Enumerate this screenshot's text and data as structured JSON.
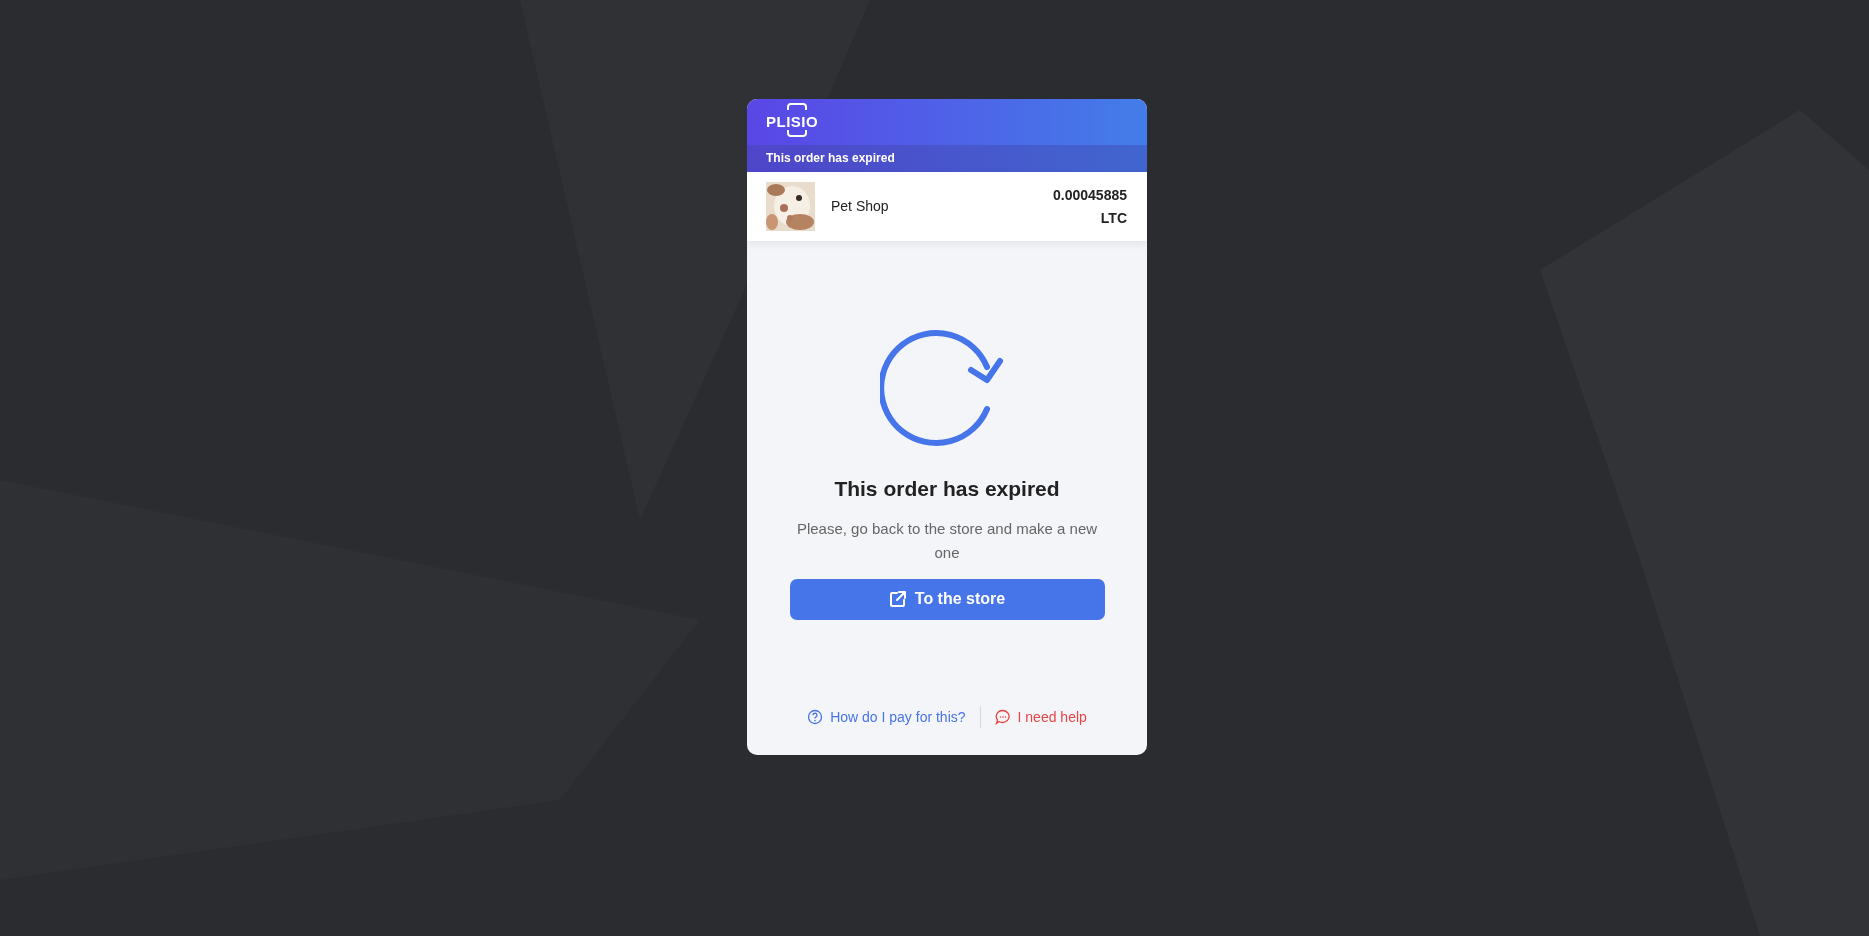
{
  "header": {
    "logo": "PLISIO",
    "status_banner": "This order has expired"
  },
  "merchant": {
    "name": "Pet Shop",
    "amount": "0.00045885",
    "currency": "LTC"
  },
  "message": {
    "title": "This order has expired",
    "text": "Please, go back to the store and make a new one",
    "button": "To the store"
  },
  "footer_links": [
    {
      "kind": "help",
      "label": "How do I pay for this?"
    },
    {
      "kind": "support",
      "label": "I need help"
    }
  ]
}
